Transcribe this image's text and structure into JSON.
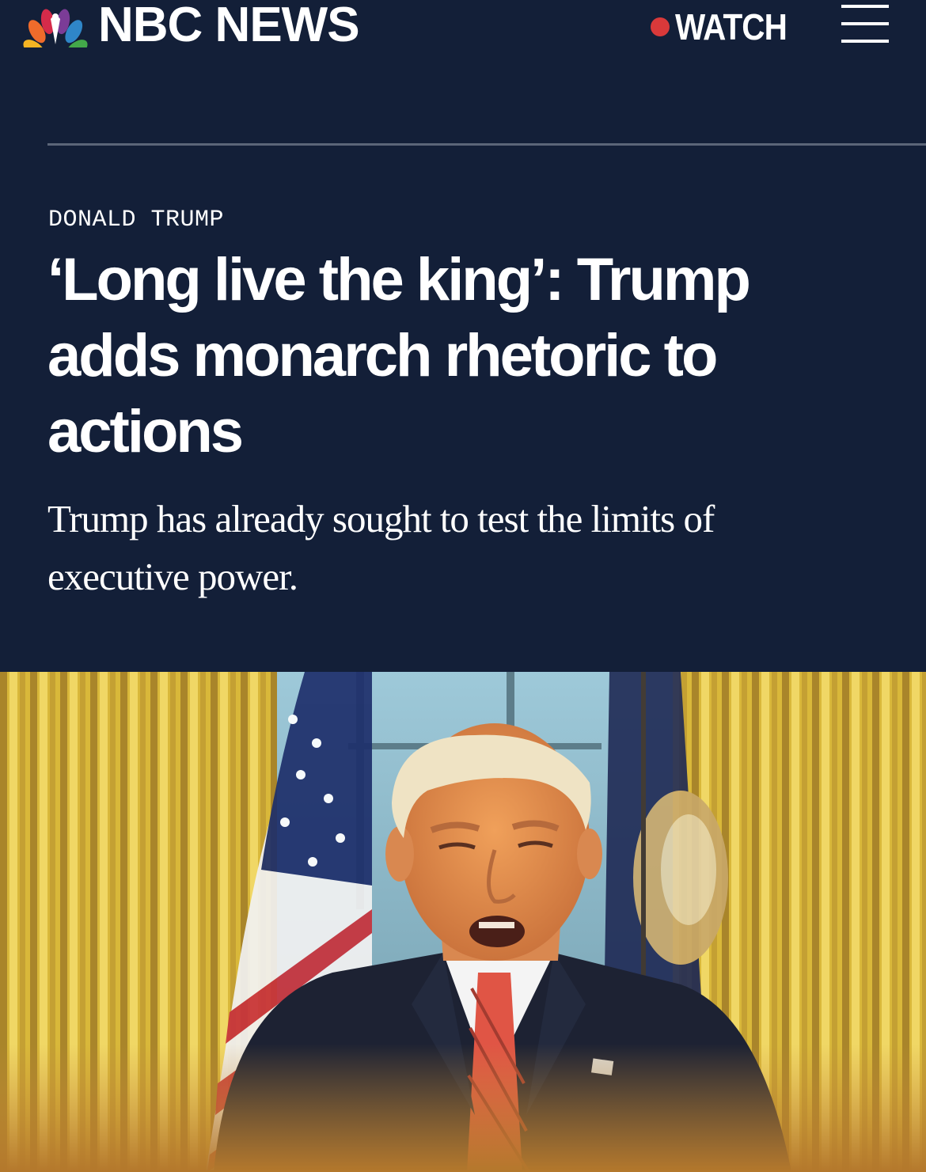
{
  "header": {
    "brand": "NBC NEWS",
    "watch_label": "WATCH",
    "live_dot_color": "#d9393a",
    "menu_icon": "hamburger-menu-icon",
    "logo_icon": "nbc-peacock-icon"
  },
  "article": {
    "section": "DONALD TRUMP",
    "headline": "‘Long live the king’: Trump adds monarch rhetoric to actions",
    "dek": "Trump has already sought to test the limits of executive power."
  },
  "colors": {
    "background": "#131f38",
    "divider": "#5b6578",
    "text": "#ffffff"
  }
}
